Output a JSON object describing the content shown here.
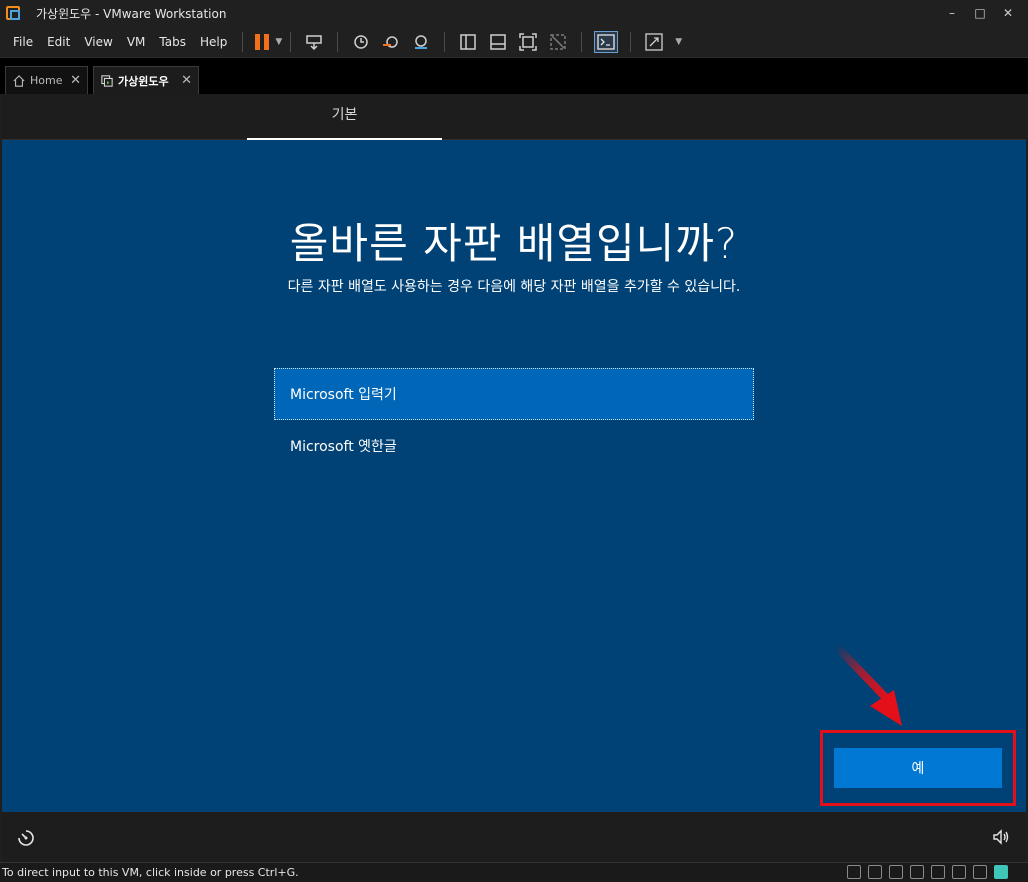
{
  "window": {
    "title": "가상윈도우 - VMware Workstation",
    "controls": [
      "–",
      "□",
      "✕"
    ]
  },
  "menu": [
    "File",
    "Edit",
    "View",
    "VM",
    "Tabs",
    "Help"
  ],
  "tabs": [
    {
      "label": "Home",
      "close": "✕"
    },
    {
      "label": "가상윈도우",
      "close": "✕"
    }
  ],
  "vm": {
    "header_tab": "기본",
    "headline": "올바른 자판 배열입니까?",
    "subtitle": "다른 자판 배열도 사용하는 경우 다음에 해당 자판 배열을 추가할 수 있습니다.",
    "options": [
      {
        "label": "Microsoft 입력기",
        "selected": true
      },
      {
        "label": "Microsoft 옛한글",
        "selected": false
      }
    ],
    "yes_button": "예"
  },
  "status": {
    "text": "To direct input to this VM, click inside or press Ctrl+G."
  },
  "colors": {
    "oobe_bg": "#004275",
    "accent": "#0078d4",
    "highlight": "#e3101a",
    "pause": "#f2701c"
  }
}
